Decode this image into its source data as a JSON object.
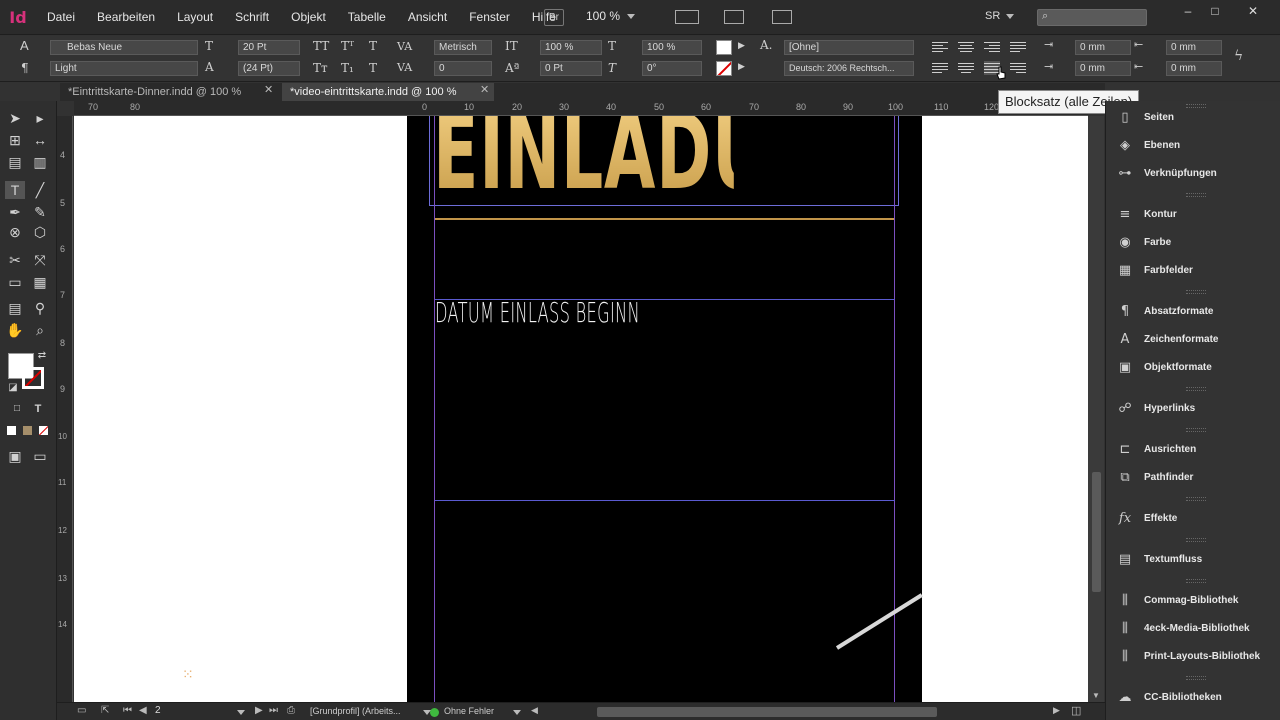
{
  "app": {
    "logo": "Id"
  },
  "menu": [
    "Datei",
    "Bearbeiten",
    "Layout",
    "Schrift",
    "Objekt",
    "Tabelle",
    "Ansicht",
    "Fenster",
    "Hilfe"
  ],
  "menubar": {
    "bridge": "Br",
    "zoom": "100 %",
    "workspace": "SR"
  },
  "control": {
    "font_family": "Bebas Neue",
    "font_style": "Light",
    "font_size": "20 Pt",
    "leading": "(24 Pt)",
    "kerning": "Metrisch",
    "tracking": "0",
    "vscale": "100 %",
    "hscale": "100 %",
    "baseline": "0 Pt",
    "skew": "0°",
    "char_style": "[Ohne]",
    "language": "Deutsch: 2006 Rechtsch...",
    "indent_left": "0 mm",
    "indent_right": "0 mm",
    "indent_first": "0 mm",
    "indent_last": "0 mm"
  },
  "tabs": [
    {
      "label": "*Eintrittskarte-Dinner.indd @ 100 %",
      "active": false
    },
    {
      "label": "*video-eintrittskarte.indd @ 100 %",
      "active": true
    }
  ],
  "ruler_h": [
    "70",
    "80",
    "0",
    "10",
    "20",
    "30",
    "40",
    "50",
    "60",
    "70",
    "80",
    "90",
    "100",
    "110",
    "120"
  ],
  "ruler_v": [
    "4",
    "5",
    "6",
    "7",
    "8",
    "9",
    "10",
    "11",
    "12",
    "13",
    "14"
  ],
  "document": {
    "title": "EINLADUNG",
    "subtitle": "DATUM EINLASS BEGINN"
  },
  "tooltip": "Blocksatz (alle Zeilen)",
  "panels": [
    {
      "label": "Seiten",
      "icon": "pages-icon"
    },
    {
      "label": "Ebenen",
      "icon": "layers-icon"
    },
    {
      "label": "Verknüpfungen",
      "icon": "links-icon"
    },
    {
      "label": "Kontur",
      "icon": "stroke-icon"
    },
    {
      "label": "Farbe",
      "icon": "color-icon"
    },
    {
      "label": "Farbfelder",
      "icon": "swatches-icon"
    },
    {
      "label": "Absatzformate",
      "icon": "paragraph-styles-icon"
    },
    {
      "label": "Zeichenformate",
      "icon": "character-styles-icon"
    },
    {
      "label": "Objektformate",
      "icon": "object-styles-icon"
    },
    {
      "label": "Hyperlinks",
      "icon": "hyperlinks-icon"
    },
    {
      "label": "Ausrichten",
      "icon": "align-icon"
    },
    {
      "label": "Pathfinder",
      "icon": "pathfinder-icon"
    },
    {
      "label": "Effekte",
      "icon": "effects-icon"
    },
    {
      "label": "Textumfluss",
      "icon": "text-wrap-icon"
    },
    {
      "label": "Commag-Bibliothek",
      "icon": "library-icon"
    },
    {
      "label": "4eck-Media-Bibliothek",
      "icon": "library-icon"
    },
    {
      "label": "Print-Layouts-Bibliothek",
      "icon": "library-icon"
    },
    {
      "label": "CC-Bibliotheken",
      "icon": "cc-libraries-icon"
    }
  ],
  "status": {
    "page": "2",
    "preflight_profile": "[Grundprofil] (Arbeits...",
    "preflight_status": "Ohne Fehler"
  },
  "colors": {
    "accent": "#d6317b",
    "gold": "#e3b862",
    "guide": "#5a5ad0",
    "ok": "#3fb83f"
  }
}
